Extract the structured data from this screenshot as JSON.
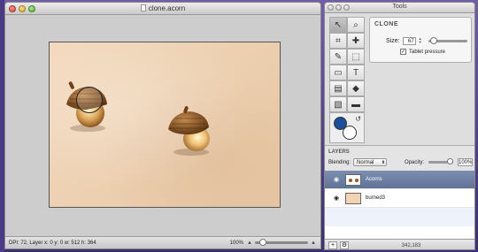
{
  "main_window": {
    "title": "clone.acorn",
    "status": "DPI: 72, Layer x: 0 y: 0 w: 512 h: 364",
    "zoom": "100%",
    "zoom_minus": "▴",
    "zoom_plus": "▴"
  },
  "tools_window": {
    "title": "Tools",
    "tools": [
      "arrow-select-icon",
      "zoom-icon",
      "crop-icon",
      "move-icon",
      "brush-icon",
      "marquee-select-icon",
      "eraser-icon",
      "text-icon",
      "gradient-icon",
      "paint-bucket-icon",
      "shape-icon",
      "rectangle-icon"
    ],
    "tool_glyphs": [
      "↖",
      "⌕",
      "⌗",
      "✚",
      "✎",
      "⬚",
      "▭",
      "T",
      "▤",
      "◆",
      "▧",
      "▬"
    ],
    "active_tool": "arrow-select-icon",
    "foreground_color": "#1a4f9e",
    "background_color": "#ffffff",
    "swap_glyph": "↺"
  },
  "clone_panel": {
    "heading": "CLONE",
    "size_label": "Size:",
    "size_value": "67",
    "tablet_pressure_label": "Tablet pressure",
    "tablet_pressure_checked": true,
    "check_glyph": "✓"
  },
  "layers": {
    "heading": "LAYERS",
    "blending_label": "Blending:",
    "blending_value": "Normal",
    "opacity_label": "Opacity:",
    "opacity_value": "100%",
    "items": [
      {
        "name": "Acorns",
        "selected": true,
        "visible": true
      },
      {
        "name": "burned3",
        "selected": false,
        "visible": true
      }
    ],
    "eye_glyph": "◉",
    "footer_add": "+",
    "footer_gear": "⚙",
    "coords": "342,183"
  },
  "colors": {
    "selection": "#5f7398",
    "canvas_bg": "#ecd0b0"
  }
}
